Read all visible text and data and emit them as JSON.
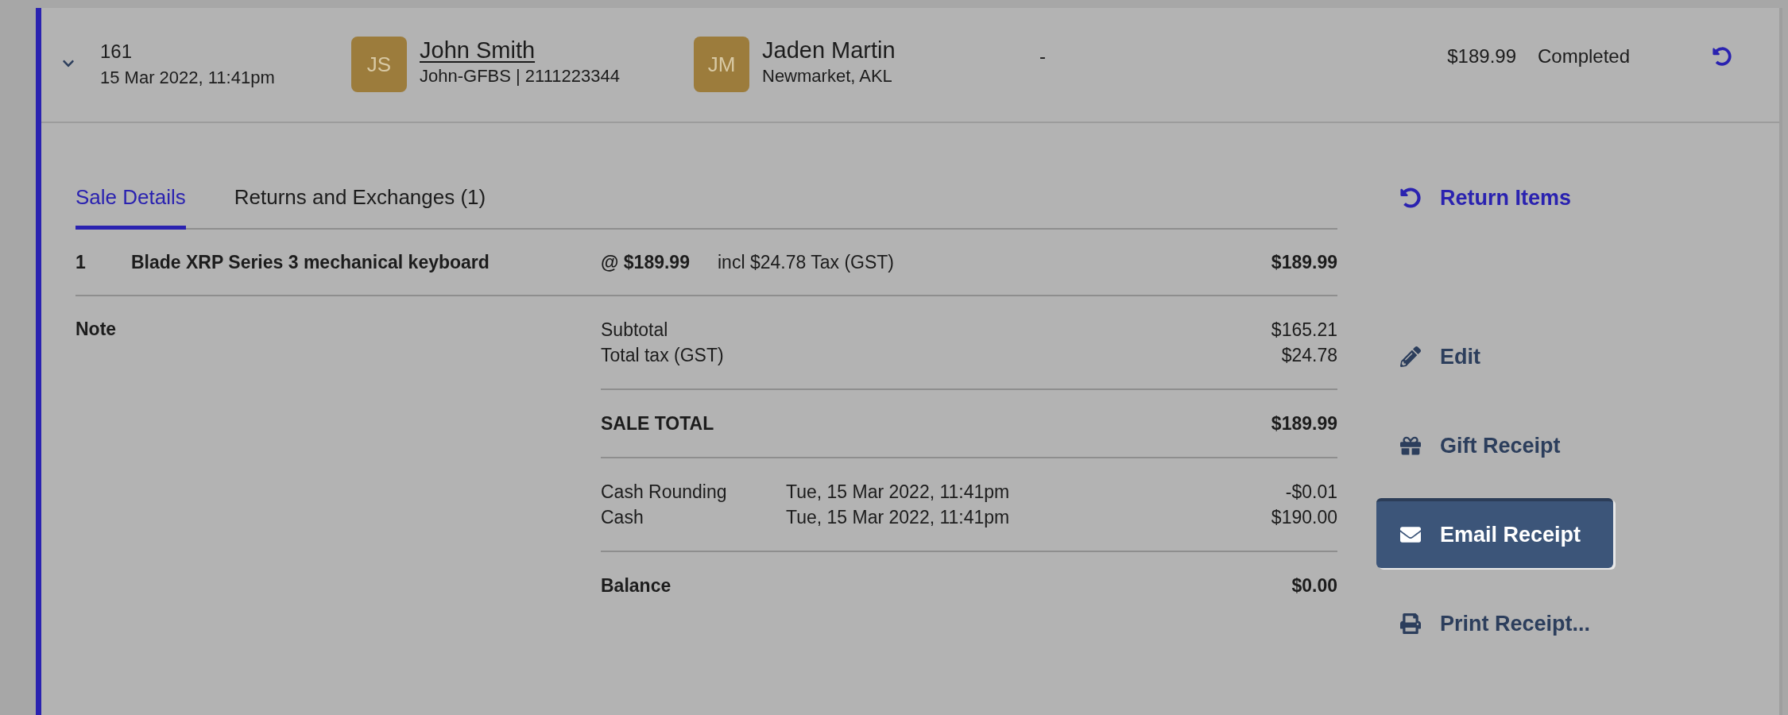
{
  "sale": {
    "expanded": true,
    "number": "161",
    "date": "15 Mar 2022, 11:41pm",
    "customer": {
      "initials": "JS",
      "name": "John Smith",
      "detail": "John-GFBS | 2111223344"
    },
    "staff": {
      "initials": "JM",
      "name": "Jaden Martin",
      "detail": "Newmarket, AKL"
    },
    "column_5": "-",
    "total": "$189.99",
    "status": "Completed"
  },
  "tabs": [
    {
      "label": "Sale Details",
      "selected": true
    },
    {
      "label": "Returns and Exchanges (1)",
      "selected": false
    }
  ],
  "line_items": [
    {
      "quantity": "1",
      "name": "Blade XRP Series 3 mechanical keyboard",
      "unit_price": "@ $189.99",
      "tax_note": "incl $24.78 Tax (GST)",
      "amount": "$189.99"
    }
  ],
  "note_label": "Note",
  "totals": [
    {
      "label": "Subtotal",
      "value": "$165.21"
    },
    {
      "label": "Total tax (GST)",
      "value": "$24.78"
    }
  ],
  "sale_total": {
    "label": "SALE TOTAL",
    "value": "$189.99"
  },
  "payments": [
    {
      "label": "Cash Rounding",
      "date": "Tue, 15 Mar 2022, 11:41pm",
      "amount": "-$0.01"
    },
    {
      "label": "Cash",
      "date": "Tue, 15 Mar 2022, 11:41pm",
      "amount": "$190.00"
    }
  ],
  "balance": {
    "label": "Balance",
    "value": "$0.00"
  },
  "return_action": {
    "label": "Return Items"
  },
  "actions": [
    {
      "kind": "link",
      "label": "Edit"
    },
    {
      "kind": "link",
      "label": "Gift Receipt"
    },
    {
      "kind": "button",
      "label": "Email Receipt"
    },
    {
      "kind": "link",
      "label": "Print Receipt..."
    }
  ]
}
